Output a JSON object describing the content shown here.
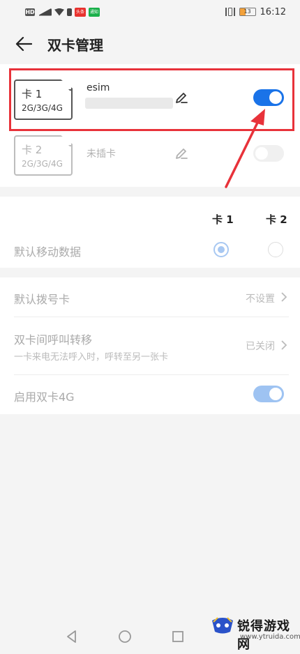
{
  "status_bar": {
    "hd": "HD",
    "app_red_label": "头条",
    "app_green_label": "通知",
    "battery": "13",
    "time": "16:12",
    "battery_color": "#f3a13a"
  },
  "header": {
    "title": "双卡管理",
    "back_icon": "arrow-left-icon"
  },
  "sims": [
    {
      "slot": "卡 1",
      "network": "2G/3G/4G",
      "name": "esim",
      "enabled": true,
      "edit_icon": "pencil-icon"
    },
    {
      "slot": "卡 2",
      "network": "2G/3G/4G",
      "name": "未插卡",
      "enabled": false,
      "edit_icon": "pencil-icon"
    }
  ],
  "default_data": {
    "col1": "卡 1",
    "col2": "卡 2",
    "label": "默认移动数据",
    "selected": "卡 1"
  },
  "settings": {
    "dial": {
      "title": "默认拨号卡",
      "value": "不设置"
    },
    "forward": {
      "title": "双卡间呼叫转移",
      "subtitle": "一卡来电无法呼入时，呼转至另一张卡",
      "value": "已关闭"
    },
    "dual4g": {
      "title": "启用双卡4G",
      "enabled": true
    }
  },
  "annotation": {
    "color": "#e8323a"
  },
  "accent_color": "#1a73e8",
  "watermark": {
    "text": "锐得游戏网",
    "url": "www.ytruida.com"
  }
}
